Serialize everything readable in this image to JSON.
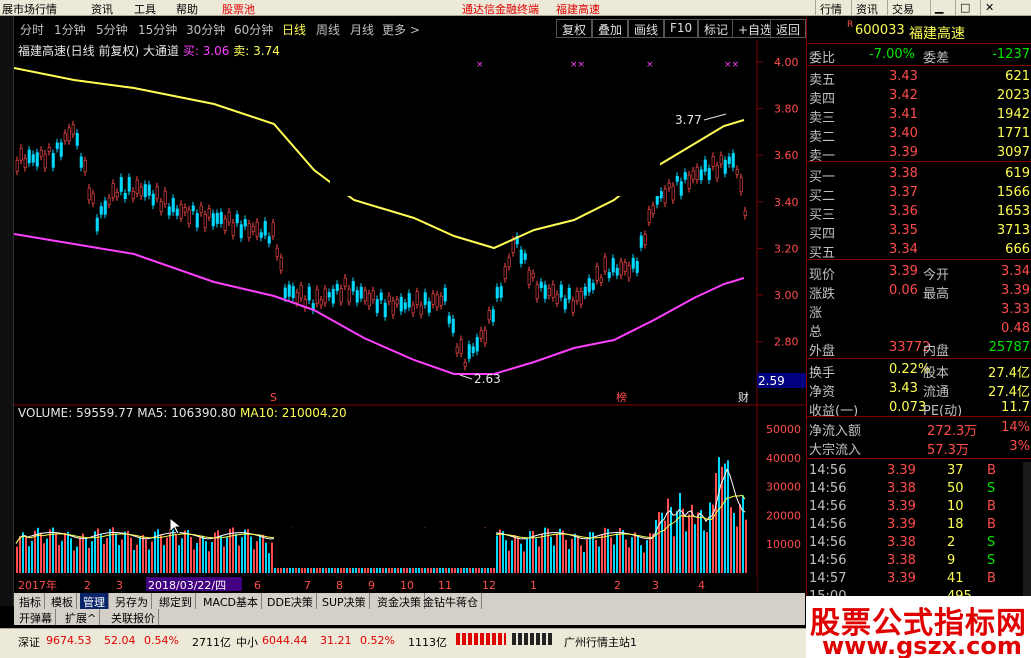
{
  "menu": {
    "items": [
      "展市场行情",
      "资讯",
      "工具",
      "帮助",
      "股票池"
    ],
    "center": [
      "通达信金融终端",
      "福建高速"
    ],
    "right": [
      "行情",
      "资讯",
      "交易"
    ]
  },
  "periods": {
    "items": [
      "分时",
      "1分钟",
      "5分钟",
      "15分钟",
      "30分钟",
      "60分钟",
      "日线",
      "周线",
      "月线",
      "更多 >"
    ],
    "active": "日线"
  },
  "toolbar": [
    "复权",
    "叠加",
    "画线",
    "F10",
    "标记",
    "+自选",
    "返回"
  ],
  "chart": {
    "header_name": "福建高速(日线 前复权) 大通道",
    "buy_label": "买:",
    "buy_value": "3.06",
    "sell_label": "卖:",
    "sell_value": "3.74",
    "price_ticks": [
      "4.00",
      "3.80",
      "3.60",
      "3.40",
      "3.20",
      "3.00",
      "2.80"
    ],
    "price_label_current": "2.59",
    "high_annotation": "3.77",
    "low_annotation": "2.63",
    "markers": [
      "S",
      "榜",
      "财"
    ],
    "volume_header": {
      "label": "VOLUME:",
      "value": "59559.77",
      "ma5_label": "MA5:",
      "ma5": "106390.80",
      "ma10_label": "MA10:",
      "ma10": "210004.20"
    },
    "volume_ticks": [
      "50000",
      "40000",
      "30000",
      "20000",
      "10000"
    ],
    "date_labels": [
      "2017年",
      "2",
      "3",
      "2018/03/22/四",
      "6",
      "7",
      "8",
      "9",
      "10",
      "11",
      "12",
      "1",
      "2",
      "3",
      "4"
    ],
    "colors": {
      "upper_band": "#ffff54",
      "lower_band": "#ff40ff",
      "candle_up": "#ff4c4c",
      "candle_down": "#00d8ff"
    }
  },
  "chart_data": {
    "type": "line",
    "title": "福建高速(日线 前复权) 大通道",
    "ylim": [
      2.59,
      4.0
    ],
    "series": [
      {
        "name": "买",
        "values": [
          3.06
        ]
      },
      {
        "name": "卖",
        "values": [
          3.74
        ]
      }
    ]
  },
  "quote": {
    "code": "600033",
    "name": "福建高速",
    "weibi_label": "委比",
    "weibi": "-7.00%",
    "weicha_label": "委差",
    "weicha": "-1237",
    "asks": [
      {
        "label": "卖五",
        "price": "3.43",
        "vol": "621"
      },
      {
        "label": "卖四",
        "price": "3.42",
        "vol": "2023"
      },
      {
        "label": "卖三",
        "price": "3.41",
        "vol": "1942"
      },
      {
        "label": "卖二",
        "price": "3.40",
        "vol": "1771"
      },
      {
        "label": "卖一",
        "price": "3.39",
        "vol": "3097"
      }
    ],
    "bids": [
      {
        "label": "买一",
        "price": "3.38",
        "vol": "619"
      },
      {
        "label": "买二",
        "price": "3.37",
        "vol": "1566"
      },
      {
        "label": "买三",
        "price": "3.36",
        "vol": "1653"
      },
      {
        "label": "买四",
        "price": "3.35",
        "vol": "3713"
      },
      {
        "label": "买五",
        "price": "3.34",
        "vol": "666"
      }
    ],
    "stats": [
      {
        "l1": "现价",
        "v1": "3.39",
        "l2": "今开",
        "v2": "3.34"
      },
      {
        "l1": "涨跌",
        "v1": "0.06",
        "l2": "最高",
        "v2": "3.39"
      },
      {
        "l1": "涨",
        "v1": "",
        "l2": "",
        "v2": "3.33"
      },
      {
        "l1": "总",
        "v1": "",
        "l2": "",
        "v2": "0.48"
      },
      {
        "l1": "外盘",
        "v1": "33772",
        "l2": "内盘",
        "v2": "25787"
      }
    ],
    "fund": [
      {
        "l1": "换手",
        "v1": "0.22%",
        "l2": "股本",
        "v2": "27.4亿"
      },
      {
        "l1": "净资",
        "v1": "3.43",
        "l2": "流通",
        "v2": "27.4亿"
      },
      {
        "l1": "收益(一)",
        "v1": "0.073",
        "l2": "PE(动)",
        "v2": "11.7"
      }
    ],
    "flow": [
      {
        "l": "净流入额",
        "v": "272.3万",
        "p": "14%"
      },
      {
        "l": "大宗流入",
        "v": "57.3万",
        "p": "3%"
      }
    ],
    "ticks": [
      {
        "t": "14:56",
        "p": "3.39",
        "v": "37",
        "d": "B"
      },
      {
        "t": "14:56",
        "p": "3.38",
        "v": "50",
        "d": "S"
      },
      {
        "t": "14:56",
        "p": "3.39",
        "v": "10",
        "d": "B"
      },
      {
        "t": "14:56",
        "p": "3.39",
        "v": "18",
        "d": "B"
      },
      {
        "t": "14:56",
        "p": "3.38",
        "v": "2",
        "d": "S"
      },
      {
        "t": "14:56",
        "p": "3.38",
        "v": "9",
        "d": "S"
      },
      {
        "t": "14:57",
        "p": "3.39",
        "v": "41",
        "d": "B"
      },
      {
        "t": "15:00",
        "p": "",
        "v": "495",
        "d": ""
      }
    ]
  },
  "tabs": [
    "指标",
    "模板",
    "管理",
    "另存为",
    "绑定到",
    "MACD基本",
    "DDE决策",
    "SUP决策",
    "资金决策",
    "金钻牛蒋仓"
  ],
  "tabs_active": "管理",
  "tabs2": [
    "开弹幕",
    "扩展^",
    "关联报价"
  ],
  "status": {
    "sh_label": "深证",
    "sh_val": "9674.53",
    "sh_chg": "52.04",
    "sh_pct": "0.54%",
    "sh_amt": "2711亿",
    "zx_label": "中小",
    "zx_val": "6044.44",
    "zx_chg": "31.21",
    "zx_pct": "0.52%",
    "zx_amt": "1113亿",
    "server": "广州行情主站1"
  },
  "watermark": {
    "line1": "股票公式指标网",
    "line2": "www.gszx.com"
  }
}
